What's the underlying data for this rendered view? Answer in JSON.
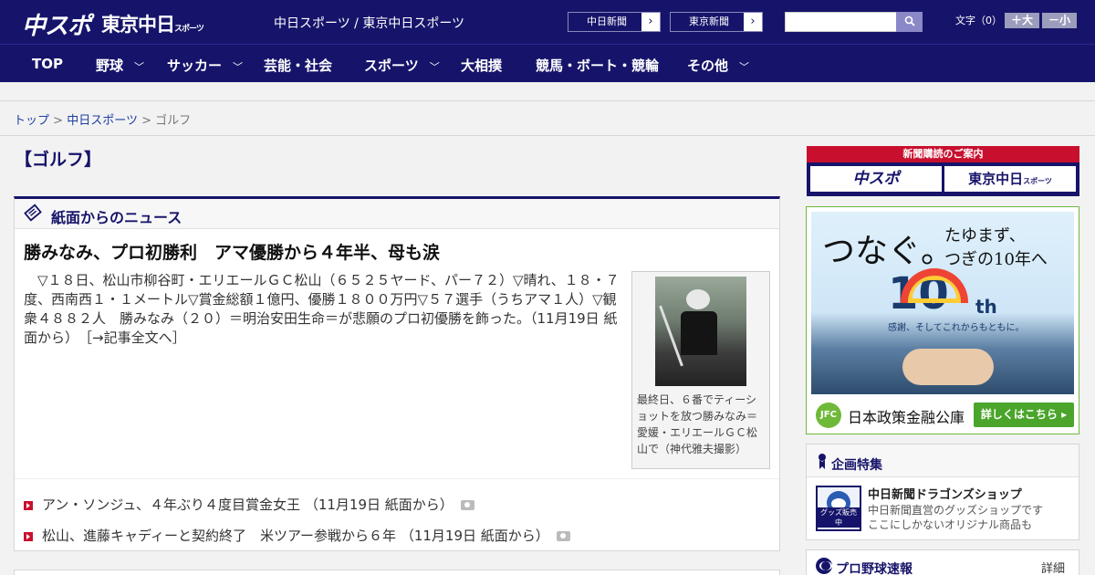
{
  "header": {
    "logo_primary": "中スポ",
    "logo_secondary": "東京中日",
    "logo_secondary_small": "スポーツ",
    "site_caption": "中日スポーツ / 東京中日スポーツ",
    "links": [
      {
        "label": "中日新聞",
        "arrow": "›"
      },
      {
        "label": "東京新聞",
        "arrow": "›"
      }
    ],
    "search": {
      "placeholder": "",
      "button_icon": "search-icon"
    },
    "font_size": {
      "label": "文字（0）",
      "plus": "＋大",
      "minus": "－小"
    }
  },
  "nav": [
    {
      "label": "TOP",
      "chevron": ""
    },
    {
      "label": "野球",
      "chevron": "﹀"
    },
    {
      "label": "サッカー",
      "chevron": "﹀"
    },
    {
      "label": "芸能・社会",
      "chevron": ""
    },
    {
      "label": "スポーツ",
      "chevron": "﹀"
    },
    {
      "label": "大相撲",
      "chevron": ""
    },
    {
      "label": "競馬・ボート・競輪",
      "chevron": ""
    },
    {
      "label": "その他",
      "chevron": "﹀"
    }
  ],
  "breadcrumb": {
    "items": [
      "トップ",
      "中日スポーツ",
      "ゴルフ"
    ],
    "separator": ">"
  },
  "page_title": "【ゴルフ】",
  "news": {
    "section_label": "紙面からのニュース",
    "headline": "勝みなみ、プロ初勝利　アマ優勝から４年半、母も涙",
    "body": "▽１８日、松山市柳谷町・エリエールＧＣ松山（６５２５ヤード、パー７２）▽晴れ、１８・７度、西南西１・１メートル▽賞金総額１億円、優勝１８００万円▽５７選手（うちアマ１人）▽観衆４８８２人　勝みなみ（２０）＝明治安田生命＝が悲願のプロ初優勝を飾った。（11月19日 紙面から）",
    "more_link": "［→記事全文へ］",
    "photo_caption": "最終日、６番でティーショットを放つ勝みなみ＝愛媛・エリエールＧＣ松山で（神代雅夫撮影）",
    "related": [
      {
        "title": "アン・ソンジュ、４年ぶり４度目賞金女王 （11月19日 紙面から）"
      },
      {
        "title": "松山、進藤キャディーと契約終了　米ツアー参戦から６年 （11月19日 紙面から）"
      }
    ]
  },
  "sidebar": {
    "subscribe": {
      "banner": "新聞購読のご案内",
      "btn1": "中スポ",
      "btn2": "東京中日",
      "btn2_small": "スポーツ"
    },
    "ad": {
      "headline_large": "つなぐ。",
      "headline_small_1": "たゆまず、",
      "headline_small_2": "つぎの10年へ",
      "tenth": "10",
      "th": "th",
      "tagline": "感謝、そしてこれからもともに。",
      "org_logo": "JFC",
      "org_name": "日本政策金融公庫",
      "cta": "詳しくはこちら ▸"
    },
    "kikaku": {
      "label": "企画特集",
      "shop_title": "中日新聞ドラゴンズショップ",
      "shop_desc_1": "中日新聞直営のグッズショップです",
      "shop_desc_2": "ここにしかないオリジナル商品も",
      "shop_badge": "グッズ販売中"
    },
    "pro_baseball": {
      "label": "プロ野球速報",
      "detail": "詳細 >"
    }
  }
}
